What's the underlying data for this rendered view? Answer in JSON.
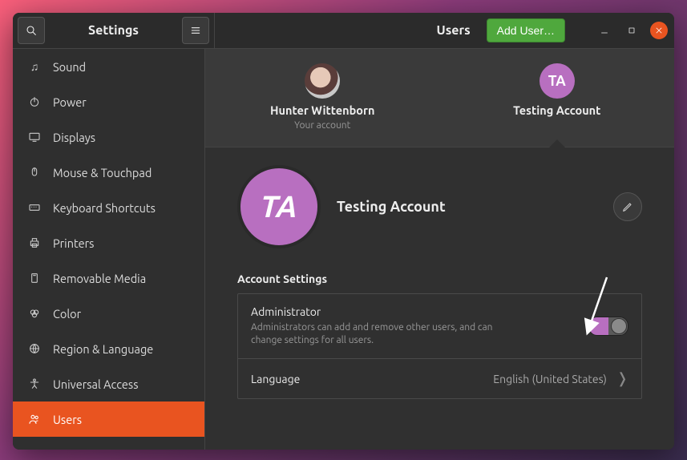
{
  "header": {
    "app_title": "Settings",
    "section": "Users",
    "add_button": "Add User…"
  },
  "sidebar": {
    "items": [
      {
        "icon": "sound-icon",
        "label": "Sound"
      },
      {
        "icon": "power-icon",
        "label": "Power"
      },
      {
        "icon": "displays-icon",
        "label": "Displays"
      },
      {
        "icon": "mouse-icon",
        "label": "Mouse & Touchpad"
      },
      {
        "icon": "keyboard-icon",
        "label": "Keyboard Shortcuts"
      },
      {
        "icon": "printers-icon",
        "label": "Printers"
      },
      {
        "icon": "removable-icon",
        "label": "Removable Media"
      },
      {
        "icon": "color-icon",
        "label": "Color"
      },
      {
        "icon": "region-icon",
        "label": "Region & Language"
      },
      {
        "icon": "accessibility-icon",
        "label": "Universal Access"
      },
      {
        "icon": "users-icon",
        "label": "Users"
      }
    ],
    "active_index": 10
  },
  "accounts": {
    "list": [
      {
        "name": "Hunter Wittenborn",
        "subtitle": "Your account",
        "initials": "",
        "photo": true
      },
      {
        "name": "Testing Account",
        "subtitle": "",
        "initials": "TA",
        "photo": false
      }
    ],
    "selected_index": 1
  },
  "detail": {
    "avatar_initials": "TA",
    "name": "Testing Account",
    "settings_heading": "Account Settings",
    "admin": {
      "label": "Administrator",
      "description": "Administrators can add and remove other users, and can change settings for all users.",
      "enabled": true
    },
    "language": {
      "label": "Language",
      "value": "English (United States)"
    }
  }
}
